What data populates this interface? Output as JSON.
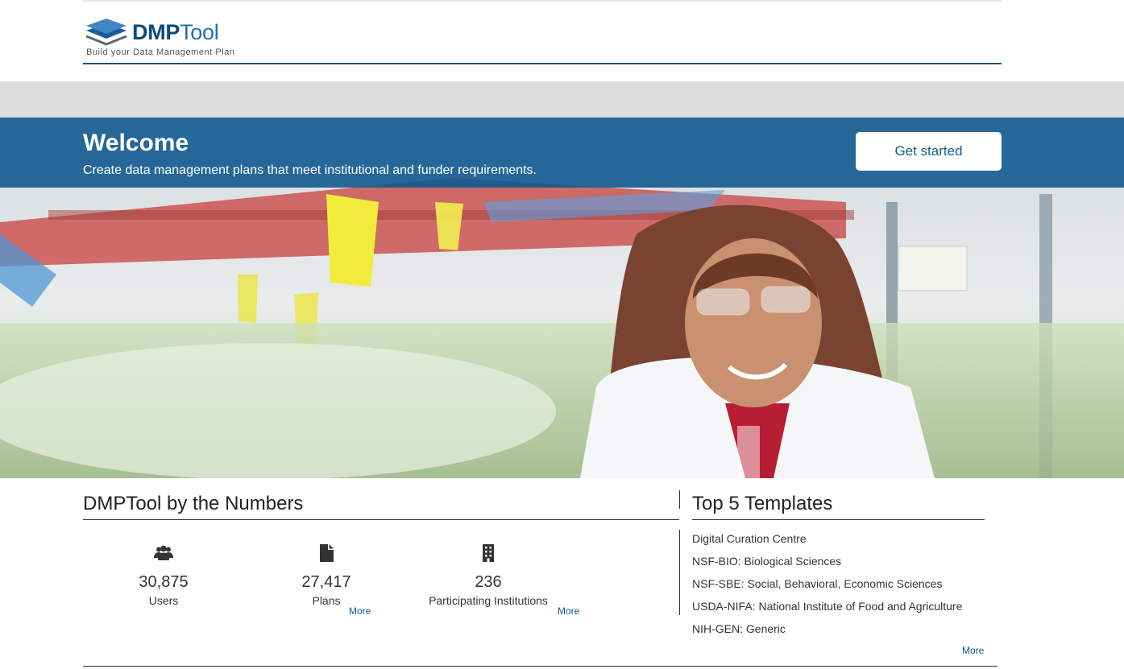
{
  "header": {
    "logo_text_bold": "DMP",
    "logo_text_light": "Tool",
    "logo_tagline": "Build your Data Management Plan"
  },
  "hero": {
    "title": "Welcome",
    "subtitle": "Create data management plans that meet institutional and funder requirements.",
    "cta_label": "Get started",
    "accent_color": "#125a91"
  },
  "numbers": {
    "title": "DMPTool by the Numbers",
    "stats": [
      {
        "icon": "users-icon",
        "value": "30,875",
        "label": "Users"
      },
      {
        "icon": "file-icon",
        "value": "27,417",
        "label": "Plans",
        "more": "More"
      },
      {
        "icon": "building-icon",
        "value": "236",
        "label": "Participating Institutions",
        "more": "More"
      }
    ]
  },
  "templates": {
    "title": "Top 5 Templates",
    "items": [
      "Digital Curation Centre",
      "NSF-BIO: Biological Sciences",
      "NSF-SBE: Social, Behavioral, Economic Sciences",
      "USDA-NIFA: National Institute of Food and Agriculture",
      "NIH-GEN: Generic"
    ],
    "more": "More"
  }
}
